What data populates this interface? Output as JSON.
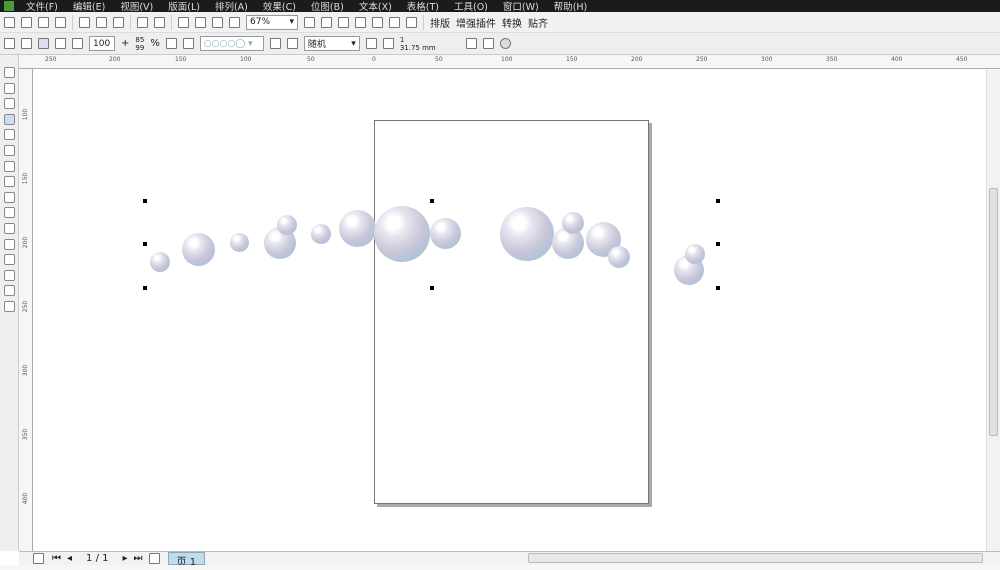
{
  "menu": [
    "文件(F)",
    "编辑(E)",
    "视图(V)",
    "版面(L)",
    "排列(A)",
    "效果(C)",
    "位图(B)",
    "文本(X)",
    "表格(T)",
    "工具(O)",
    "窗口(W)",
    "帮助(H)"
  ],
  "toolbar": {
    "zoom": "67%",
    "plugins": [
      "排版",
      "增强插件",
      "转换",
      "贴齐"
    ]
  },
  "propbar": {
    "size": "100",
    "pct1": "85",
    "pct2": "99",
    "pct_unit": "%",
    "mode": "随机",
    "count": "1",
    "distance": "31.75 mm"
  },
  "ruler_h": [
    "250",
    "200",
    "150",
    "100",
    "50",
    "0",
    "50",
    "100",
    "150",
    "200",
    "250",
    "300",
    "350",
    "400",
    "450"
  ],
  "ruler_v": [
    "100",
    "150",
    "200",
    "250",
    "300",
    "350",
    "400"
  ],
  "nav": {
    "page_count": "1 / 1",
    "page_tab": "页 1"
  }
}
